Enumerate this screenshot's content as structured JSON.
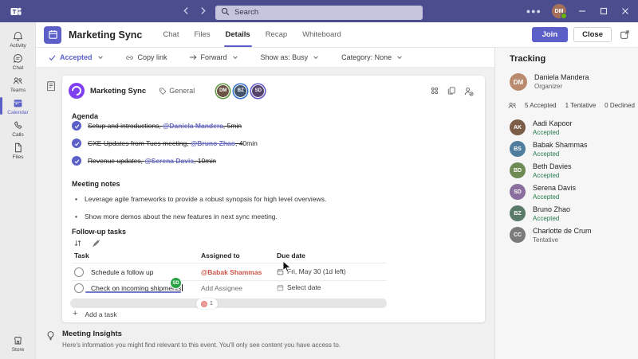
{
  "colors": {
    "brand_purple": "#5b5fc7",
    "titlebar_purple": "#4b4d8f",
    "accepted_green": "#237b4b",
    "assignee_mention_red": "#cc5449",
    "collab_badge_green": "#27a343"
  },
  "titlebar": {
    "search_placeholder": "Search"
  },
  "sidebar": {
    "items": [
      {
        "label": "Activity"
      },
      {
        "label": "Chat"
      },
      {
        "label": "Teams"
      },
      {
        "label": "Calendar"
      },
      {
        "label": "Calls"
      },
      {
        "label": "Files"
      }
    ],
    "store_label": "Store"
  },
  "header": {
    "title": "Marketing Sync",
    "tabs": [
      {
        "label": "Chat"
      },
      {
        "label": "Files"
      },
      {
        "label": "Details"
      },
      {
        "label": "Recap"
      },
      {
        "label": "Whiteboard"
      }
    ],
    "join_label": "Join",
    "close_label": "Close"
  },
  "toolbar": {
    "accepted": "Accepted",
    "copy_link": "Copy link",
    "forward": "Forward",
    "show_as": "Show as: Busy",
    "category": "Category: None"
  },
  "card": {
    "title": "Marketing Sync",
    "channel": "General",
    "presenters": [
      {
        "initials": "DM"
      },
      {
        "initials": "BZ"
      },
      {
        "initials": "SD"
      }
    ],
    "agenda": {
      "heading": "Agenda",
      "items": [
        {
          "before": "Setup and introductions, ",
          "mention": "@Daniela Mandera",
          "after_struck": ", 5min",
          "after_plain": ""
        },
        {
          "before": "CXE Updates from Tues meeting, ",
          "mention": "@Bruno Zhao",
          "after_struck": ", 4",
          "after_plain": "0min"
        },
        {
          "before": "Revenue updates, ",
          "mention": "@Serena Davis",
          "after_struck": ", 10min",
          "after_plain": ""
        }
      ]
    },
    "notes": {
      "heading": "Meeting notes",
      "bullets": [
        {
          "text": "Leverage agile frameworks to provide a robust synopsis for high level overviews."
        },
        {
          "text": "Show more demos about the new features in next sync meeting."
        }
      ]
    },
    "tasks": {
      "heading": "Follow-up tasks",
      "columns": [
        {
          "label": "Task"
        },
        {
          "label": "Assigned to"
        },
        {
          "label": "Due date"
        }
      ],
      "rows": [
        {
          "task": "Schedule a follow up",
          "assignee": "@Babak Shammas",
          "due": "Fri, May 30 (1d left)"
        },
        {
          "task": "Check on incoming shipments",
          "assignee": "Add Assignee",
          "due": "Select date",
          "collab_badge": "SD"
        }
      ],
      "reaction_count": "1",
      "add_label": "Add a task"
    }
  },
  "tracking": {
    "title": "Tracking",
    "organizer": {
      "name": "Daniela Mandera",
      "role": "Organizer",
      "initials": "DM"
    },
    "summary": {
      "accepted": "5 Accepted",
      "tentative": "1 Tentative",
      "declined": "0 Declined"
    },
    "attendees": [
      {
        "name": "Aadi Kapoor",
        "status": "Accepted",
        "initials": "AK"
      },
      {
        "name": "Babak Shammas",
        "status": "Accepted",
        "initials": "BS"
      },
      {
        "name": "Beth Davies",
        "status": "Accepted",
        "initials": "BD"
      },
      {
        "name": "Serena Davis",
        "status": "Accepted",
        "initials": "SD"
      },
      {
        "name": "Bruno Zhao",
        "status": "Accepted",
        "initials": "BZ"
      },
      {
        "name": "Charlotte de Crum",
        "status": "Tentative",
        "initials": "CC"
      }
    ]
  },
  "insights": {
    "title": "Meeting Insights",
    "description": "Here's information you might find relevant to this event. You'll only see content you have access to."
  }
}
